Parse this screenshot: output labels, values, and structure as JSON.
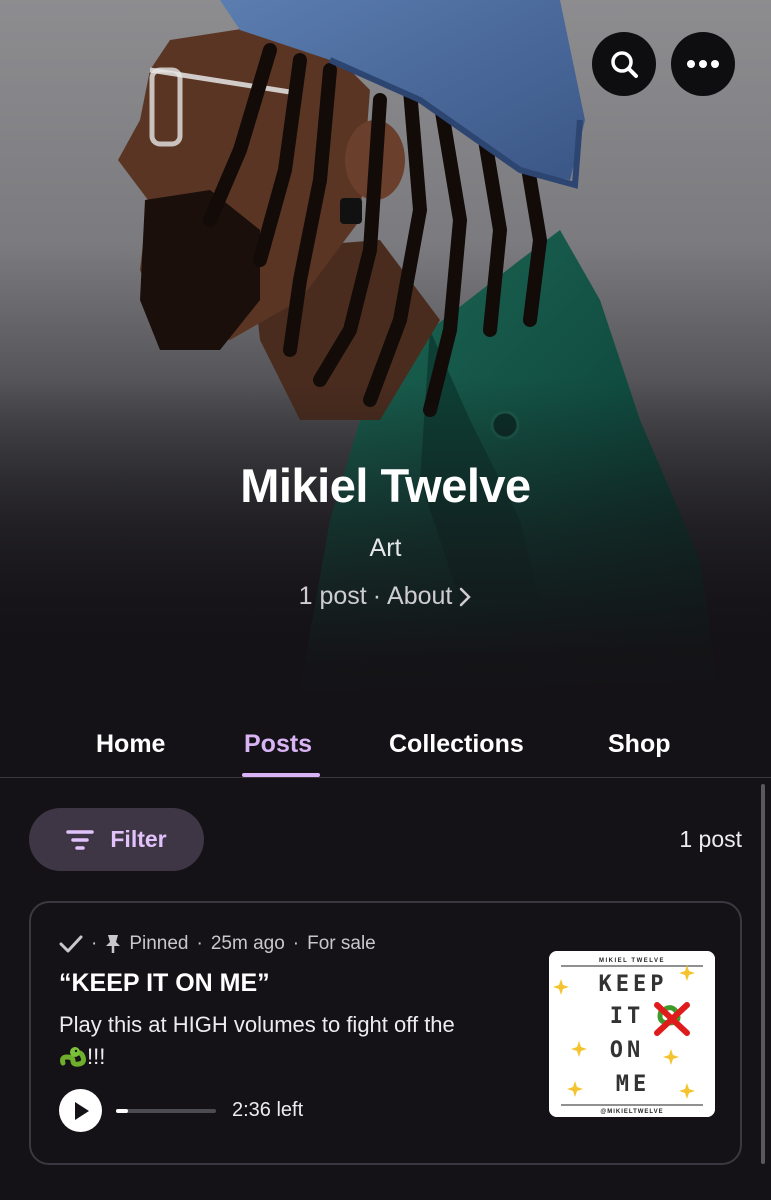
{
  "hero": {
    "creator_name": "Mikiel Twelve",
    "category": "Art",
    "post_count": "1 post",
    "separator": "·",
    "about_label": "About"
  },
  "header_buttons": {
    "search_icon": "search-icon",
    "more_icon": "more-icon"
  },
  "tabs": [
    {
      "label": "Home",
      "active": false
    },
    {
      "label": "Posts",
      "active": true
    },
    {
      "label": "Collections",
      "active": false
    },
    {
      "label": "Shop",
      "active": false
    }
  ],
  "filter": {
    "label": "Filter",
    "count_text": "1 post"
  },
  "post": {
    "status_icon": "check-icon",
    "pin_icon": "pin-icon",
    "pinned_label": "Pinned",
    "time_ago": "25m ago",
    "sale_label": "For sale",
    "dot": "·",
    "title": "“KEEP IT ON ME”",
    "description": "Play this at HIGH volumes to fight off the",
    "description_suffix": "!!!",
    "audio": {
      "progress": 0.12,
      "time_left": "2:36 left"
    },
    "thumbnail": {
      "artist_header": "MIKIEL TWELVE",
      "words": [
        "KEEP",
        "IT",
        "ON",
        "ME"
      ],
      "handle": "@MIKIELTWELVE"
    }
  },
  "colors": {
    "accent": "#d8b4f5",
    "background": "#141216",
    "filter_bg": "#3e3645"
  }
}
